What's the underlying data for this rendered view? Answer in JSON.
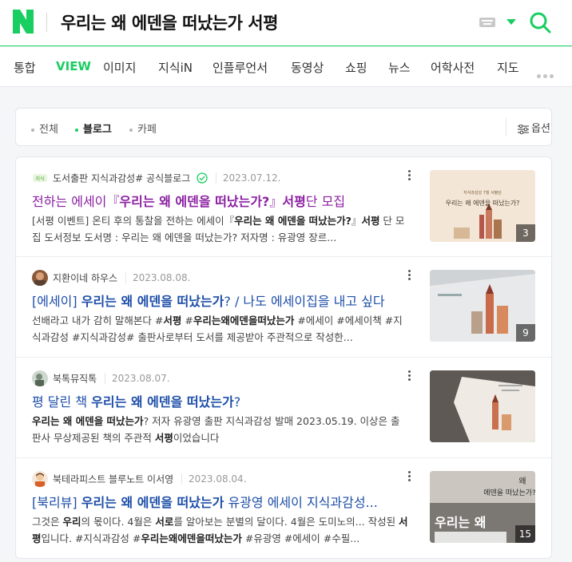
{
  "header": {
    "query": "우리는 왜 에덴을 떠났는가 서평"
  },
  "tabs": [
    "통합",
    "VIEW",
    "이미지",
    "지식iN",
    "인플루언서",
    "동영상",
    "쇼핑",
    "뉴스",
    "어학사전",
    "지도"
  ],
  "active_tab": "VIEW",
  "filter": {
    "items": [
      "전체",
      "블로그",
      "카페"
    ],
    "active": "블로그",
    "options_label": "옵션"
  },
  "results": [
    {
      "source": "도서출판 지식과감성# 공식블로그",
      "date": "2023.07.12.",
      "verified": true,
      "title_parts": [
        "전하는 에세이『",
        "우리는 왜 에덴을 떠났는가?",
        "』",
        "서평",
        "단 모집"
      ],
      "desc_parts": [
        "[서평 이벤트] 온티 후의 통찰을 전하는 에세이『",
        "우리는 왜 에덴을 떠났는가?",
        "』",
        "서평",
        " 단 모집 도서정보 도서명 : 우리는 왜 에덴을 떠났는가? 저자명 : 유광영 장르..."
      ],
      "thumb_count": "3",
      "thumb_text": "우리는 왜 에덴을 떠났는가?",
      "thumb_caption": "지식과감성 7월 서평단",
      "thumb_bg": "#f3e6d6"
    },
    {
      "source": "지환이네 하우스",
      "date": "2023.08.08.",
      "verified": false,
      "title_parts": [
        "[에세이] ",
        "우리는 왜 에덴을 떠났는가",
        "? / 나도 에세이집을 내고 싶다"
      ],
      "desc_parts": [
        "선배라고 내가 감히 말해본다 #",
        "서평",
        " #",
        "우리는왜에덴을떠났는가",
        " #에세이 #에세이책 #지식과감성 #지식과감성# 출판사로부터 도서를 제공받아 주관적으로 작성한..."
      ],
      "thumb_count": "9",
      "thumb_bg": "#d9dcdf"
    },
    {
      "source": "북톡뮤직톡",
      "date": "2023.08.07.",
      "verified": false,
      "title_parts": [
        "평 달린 책 ",
        "우리는 왜 에덴을 떠났는가",
        "?"
      ],
      "desc_parts": [
        "우리는 왜 에덴을 떠났는가",
        "? 저자 유광영 출판 지식과감성 발매 2023.05.19. 이상은 출판사 무상제공된 책의 주관적 ",
        "서평",
        "이었습니다"
      ],
      "thumb_count": "",
      "thumb_bg": "#6b6560"
    },
    {
      "source": "북테라피스트 블루노트 이서영",
      "date": "2023.08.04.",
      "verified": false,
      "title_parts": [
        "[북리뷰] ",
        "우리는 왜 에덴을 떠났는가",
        " 유광영 에세이 지식과감성..."
      ],
      "desc_parts": [
        "그것은 ",
        "우리",
        "의 몫이다. 4월은 ",
        "서로",
        "를 알아보는 분별의 달이다. 4월은 도미노의... 작성된 ",
        "서평",
        "입니다. #지식과감성 #",
        "우리는왜에덴을떠났는가",
        " #유광영 #에세이 #수필..."
      ],
      "thumb_count": "15",
      "thumb_text": "우리는 왜",
      "thumb_text2": "에덴을 떠났는가?",
      "thumb_top": "왜",
      "thumb_bg": "#cfcac4"
    }
  ],
  "colors": {
    "brand": "#19ce60",
    "link": "#1d4ea8",
    "visited": "#8b1fa1"
  }
}
